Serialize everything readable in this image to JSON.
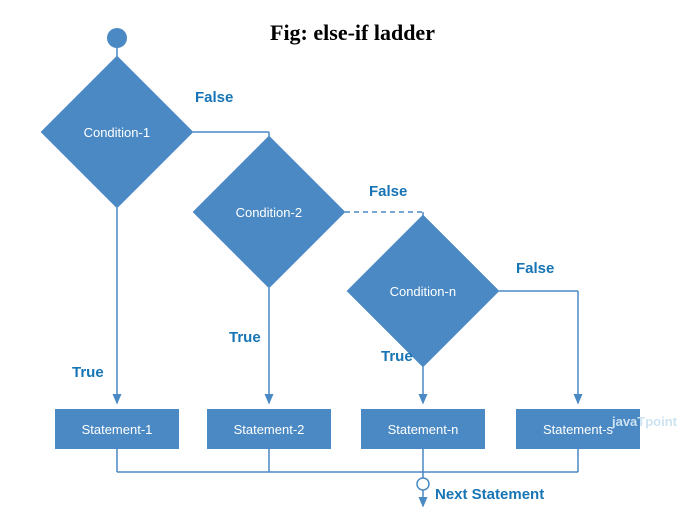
{
  "chart_data": {
    "type": "flowchart",
    "title": "Fig: else-if ladder",
    "nodes": [
      {
        "id": "start",
        "type": "start",
        "label": ""
      },
      {
        "id": "cond1",
        "type": "decision",
        "label": "Condition-1"
      },
      {
        "id": "cond2",
        "type": "decision",
        "label": "Condition-2"
      },
      {
        "id": "condn",
        "type": "decision",
        "label": "Condition-n"
      },
      {
        "id": "stmt1",
        "type": "process",
        "label": "Statement-1"
      },
      {
        "id": "stmt2",
        "type": "process",
        "label": "Statement-2"
      },
      {
        "id": "stmtn",
        "type": "process",
        "label": "Statement-n"
      },
      {
        "id": "stmts",
        "type": "process",
        "label": "Statement-s"
      },
      {
        "id": "next",
        "type": "label",
        "label": "Next Statement"
      }
    ],
    "edges": [
      {
        "from": "start",
        "to": "cond1",
        "label": ""
      },
      {
        "from": "cond1",
        "to": "stmt1",
        "label": "True"
      },
      {
        "from": "cond1",
        "to": "cond2",
        "label": "False"
      },
      {
        "from": "cond2",
        "to": "stmt2",
        "label": "True"
      },
      {
        "from": "cond2",
        "to": "condn",
        "label": "False",
        "style": "dashed"
      },
      {
        "from": "condn",
        "to": "stmtn",
        "label": "True"
      },
      {
        "from": "condn",
        "to": "stmts",
        "label": "False"
      },
      {
        "from": "stmt1",
        "to": "next",
        "label": ""
      },
      {
        "from": "stmt2",
        "to": "next",
        "label": ""
      },
      {
        "from": "stmtn",
        "to": "next",
        "label": ""
      },
      {
        "from": "stmts",
        "to": "next",
        "label": ""
      }
    ]
  },
  "title": "Fig: else-if ladder",
  "conditions": {
    "c1": "Condition-1",
    "c2": "Condition-2",
    "cn": "Condition-n"
  },
  "statements": {
    "s1": "Statement-1",
    "s2": "Statement-2",
    "sn": "Statement-n",
    "ss": "Statement-s"
  },
  "labels": {
    "true": "True",
    "false": "False",
    "next": "Next Statement"
  },
  "watermark": "javaTpoint"
}
